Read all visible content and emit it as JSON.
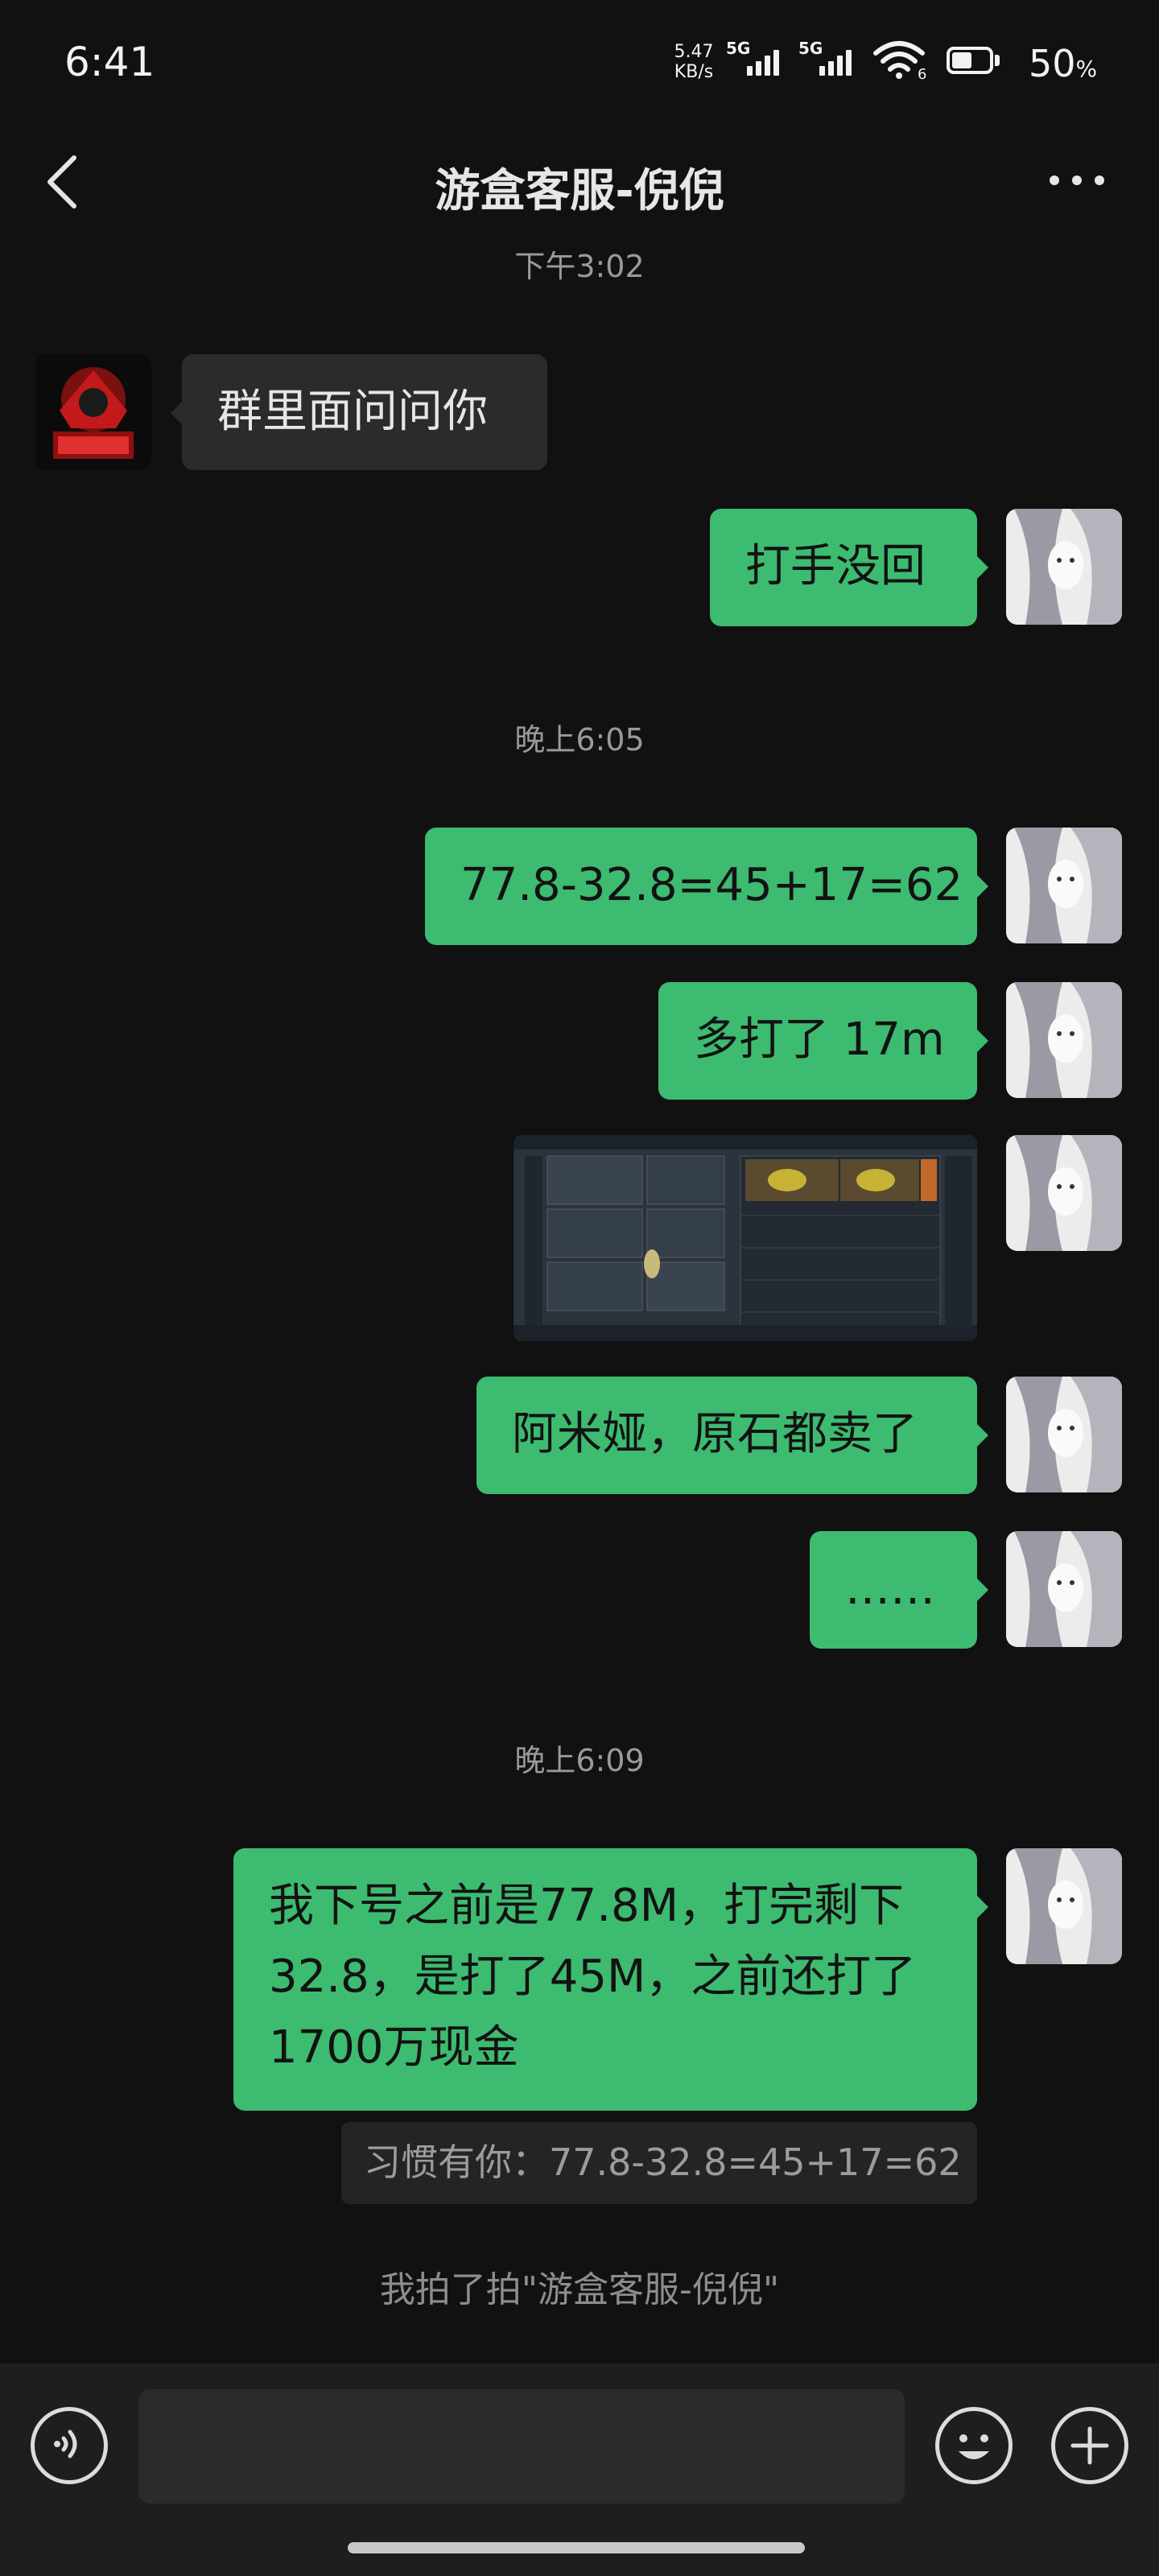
{
  "status_bar": {
    "time": "6:41",
    "net_speed_value": "5.47",
    "net_speed_unit": "KB/s",
    "sim1_label": "5G",
    "sim2_label": "5G",
    "wifi_badge": "6",
    "battery_value": "50",
    "battery_unit": "%"
  },
  "header": {
    "title": "游盒客服-倪倪",
    "back_icon": "chevron-left-icon",
    "more_icon": "more-dots-icon"
  },
  "messages": {
    "time1": "下午3:02",
    "m1": "群里面问问你",
    "m2": "打手没回",
    "time2": "晚上6:05",
    "m3": "77.8-32.8=45+17=62",
    "m4": "多打了 17m",
    "m5_image": "game-inventory-screenshot",
    "m6": "阿米娅，原石都卖了",
    "m7": "……",
    "time3": "晚上6:09",
    "m8_line1": "我下号之前是77.8M，打完剩下",
    "m8_line2": "32.8，是打了45M，之前还打了",
    "m8_line3": "1700万现金",
    "quote": "习惯有你：77.8-32.8=45+17=62",
    "system_note": "我拍了拍\"游盒客服-倪倪\""
  },
  "bottom": {
    "voice_icon": "voice-icon",
    "emoji_icon": "emoji-icon",
    "plus_icon": "plus-icon",
    "input_value": ""
  },
  "colors": {
    "background": "#111111",
    "outgoing_bubble": "#3dbb70",
    "incoming_bubble": "#2b2b2b"
  }
}
